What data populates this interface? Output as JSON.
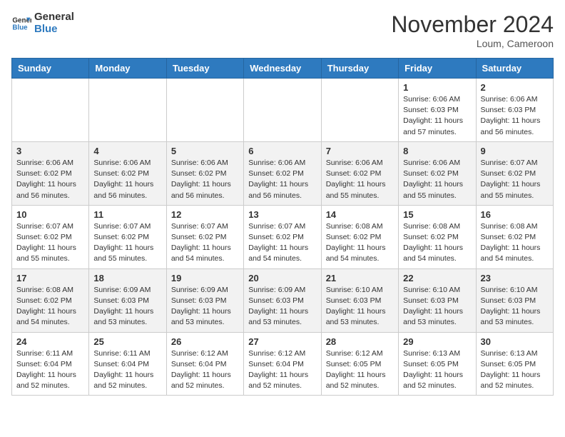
{
  "header": {
    "logo_line1": "General",
    "logo_line2": "Blue",
    "month_title": "November 2024",
    "location": "Loum, Cameroon"
  },
  "weekdays": [
    "Sunday",
    "Monday",
    "Tuesday",
    "Wednesday",
    "Thursday",
    "Friday",
    "Saturday"
  ],
  "weeks": [
    [
      {
        "day": "",
        "info": ""
      },
      {
        "day": "",
        "info": ""
      },
      {
        "day": "",
        "info": ""
      },
      {
        "day": "",
        "info": ""
      },
      {
        "day": "",
        "info": ""
      },
      {
        "day": "1",
        "info": "Sunrise: 6:06 AM\nSunset: 6:03 PM\nDaylight: 11 hours\nand 57 minutes."
      },
      {
        "day": "2",
        "info": "Sunrise: 6:06 AM\nSunset: 6:03 PM\nDaylight: 11 hours\nand 56 minutes."
      }
    ],
    [
      {
        "day": "3",
        "info": "Sunrise: 6:06 AM\nSunset: 6:02 PM\nDaylight: 11 hours\nand 56 minutes."
      },
      {
        "day": "4",
        "info": "Sunrise: 6:06 AM\nSunset: 6:02 PM\nDaylight: 11 hours\nand 56 minutes."
      },
      {
        "day": "5",
        "info": "Sunrise: 6:06 AM\nSunset: 6:02 PM\nDaylight: 11 hours\nand 56 minutes."
      },
      {
        "day": "6",
        "info": "Sunrise: 6:06 AM\nSunset: 6:02 PM\nDaylight: 11 hours\nand 56 minutes."
      },
      {
        "day": "7",
        "info": "Sunrise: 6:06 AM\nSunset: 6:02 PM\nDaylight: 11 hours\nand 55 minutes."
      },
      {
        "day": "8",
        "info": "Sunrise: 6:06 AM\nSunset: 6:02 PM\nDaylight: 11 hours\nand 55 minutes."
      },
      {
        "day": "9",
        "info": "Sunrise: 6:07 AM\nSunset: 6:02 PM\nDaylight: 11 hours\nand 55 minutes."
      }
    ],
    [
      {
        "day": "10",
        "info": "Sunrise: 6:07 AM\nSunset: 6:02 PM\nDaylight: 11 hours\nand 55 minutes."
      },
      {
        "day": "11",
        "info": "Sunrise: 6:07 AM\nSunset: 6:02 PM\nDaylight: 11 hours\nand 55 minutes."
      },
      {
        "day": "12",
        "info": "Sunrise: 6:07 AM\nSunset: 6:02 PM\nDaylight: 11 hours\nand 54 minutes."
      },
      {
        "day": "13",
        "info": "Sunrise: 6:07 AM\nSunset: 6:02 PM\nDaylight: 11 hours\nand 54 minutes."
      },
      {
        "day": "14",
        "info": "Sunrise: 6:08 AM\nSunset: 6:02 PM\nDaylight: 11 hours\nand 54 minutes."
      },
      {
        "day": "15",
        "info": "Sunrise: 6:08 AM\nSunset: 6:02 PM\nDaylight: 11 hours\nand 54 minutes."
      },
      {
        "day": "16",
        "info": "Sunrise: 6:08 AM\nSunset: 6:02 PM\nDaylight: 11 hours\nand 54 minutes."
      }
    ],
    [
      {
        "day": "17",
        "info": "Sunrise: 6:08 AM\nSunset: 6:02 PM\nDaylight: 11 hours\nand 54 minutes."
      },
      {
        "day": "18",
        "info": "Sunrise: 6:09 AM\nSunset: 6:03 PM\nDaylight: 11 hours\nand 53 minutes."
      },
      {
        "day": "19",
        "info": "Sunrise: 6:09 AM\nSunset: 6:03 PM\nDaylight: 11 hours\nand 53 minutes."
      },
      {
        "day": "20",
        "info": "Sunrise: 6:09 AM\nSunset: 6:03 PM\nDaylight: 11 hours\nand 53 minutes."
      },
      {
        "day": "21",
        "info": "Sunrise: 6:10 AM\nSunset: 6:03 PM\nDaylight: 11 hours\nand 53 minutes."
      },
      {
        "day": "22",
        "info": "Sunrise: 6:10 AM\nSunset: 6:03 PM\nDaylight: 11 hours\nand 53 minutes."
      },
      {
        "day": "23",
        "info": "Sunrise: 6:10 AM\nSunset: 6:03 PM\nDaylight: 11 hours\nand 53 minutes."
      }
    ],
    [
      {
        "day": "24",
        "info": "Sunrise: 6:11 AM\nSunset: 6:04 PM\nDaylight: 11 hours\nand 52 minutes."
      },
      {
        "day": "25",
        "info": "Sunrise: 6:11 AM\nSunset: 6:04 PM\nDaylight: 11 hours\nand 52 minutes."
      },
      {
        "day": "26",
        "info": "Sunrise: 6:12 AM\nSunset: 6:04 PM\nDaylight: 11 hours\nand 52 minutes."
      },
      {
        "day": "27",
        "info": "Sunrise: 6:12 AM\nSunset: 6:04 PM\nDaylight: 11 hours\nand 52 minutes."
      },
      {
        "day": "28",
        "info": "Sunrise: 6:12 AM\nSunset: 6:05 PM\nDaylight: 11 hours\nand 52 minutes."
      },
      {
        "day": "29",
        "info": "Sunrise: 6:13 AM\nSunset: 6:05 PM\nDaylight: 11 hours\nand 52 minutes."
      },
      {
        "day": "30",
        "info": "Sunrise: 6:13 AM\nSunset: 6:05 PM\nDaylight: 11 hours\nand 52 minutes."
      }
    ]
  ]
}
